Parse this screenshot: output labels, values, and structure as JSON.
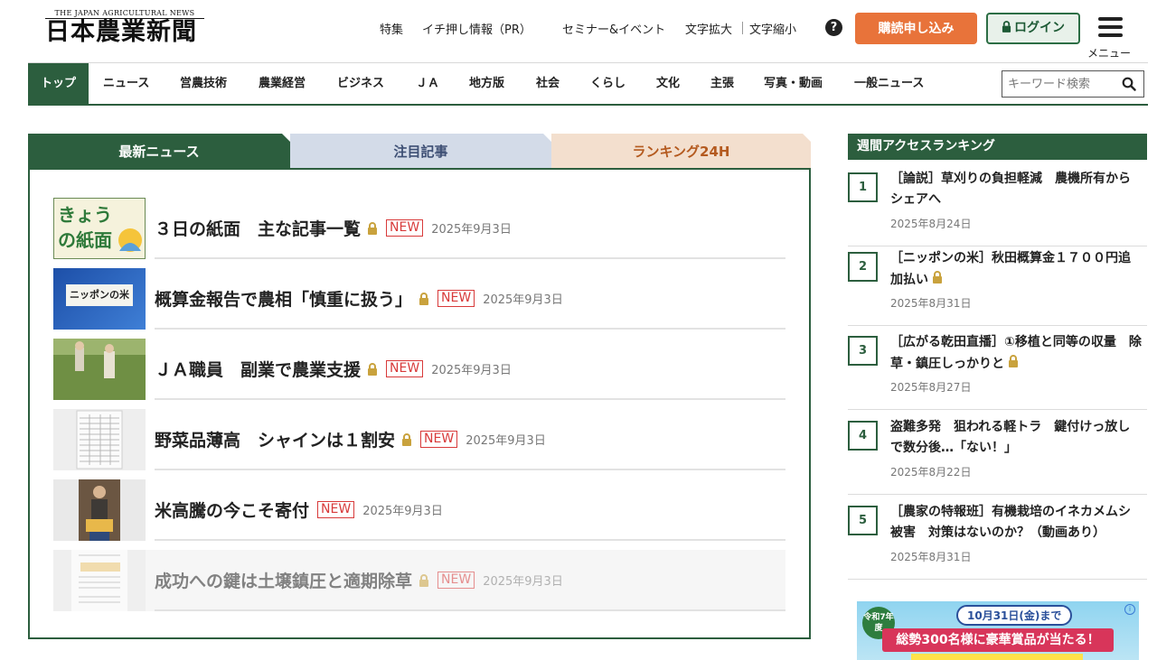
{
  "header": {
    "logo_sub": "THE JAPAN AGRICULTURAL NEWS",
    "logo_main": "日本農業新聞",
    "links": [
      "特集",
      "イチ押し情報（PR）",
      "セミナー&イベント",
      "文字拡大",
      "文字縮小"
    ],
    "subscribe": "購読申し込み",
    "login": "ログイン",
    "menu": "メニュー"
  },
  "nav": {
    "categories": [
      "トップ",
      "ニュース",
      "営農技術",
      "農業経営",
      "ビジネス",
      "ＪＡ",
      "地方版",
      "社会",
      "くらし",
      "文化",
      "主張",
      "写真・動画",
      "一般ニュース"
    ],
    "search_placeholder": "キーワード検索"
  },
  "tabs": [
    "最新ニュース",
    "注目記事",
    "ランキング24H"
  ],
  "news": [
    {
      "title": "３日の紙面　主な記事一覧",
      "locked": true,
      "badge": "NEW",
      "date": "2025年9月3日",
      "thumb_text": "きょうの紙面"
    },
    {
      "title": "概算金報告で農相「慎重に扱う」",
      "locked": true,
      "badge": "NEW",
      "date": "2025年9月3日",
      "thumb_text": "ニッポンの米"
    },
    {
      "title": "ＪＡ職員　副業で農業支援",
      "locked": true,
      "badge": "NEW",
      "date": "2025年9月3日"
    },
    {
      "title": "野菜品薄高　シャインは１割安",
      "locked": true,
      "badge": "NEW",
      "date": "2025年9月3日"
    },
    {
      "title": "米高騰の今こそ寄付",
      "locked": false,
      "badge": "NEW",
      "date": "2025年9月3日"
    },
    {
      "title": "成功への鍵は土壌鎮圧と適期除草",
      "locked": true,
      "badge": "NEW",
      "date": "2025年9月3日"
    }
  ],
  "ranking": {
    "header": "週間アクセスランキング",
    "items": [
      {
        "rank": "1",
        "title": "［論説］草刈りの負担軽減　農機所有からシェアへ",
        "locked": false,
        "date": "2025年8月24日"
      },
      {
        "rank": "2",
        "title": "［ニッポンの米］秋田概算金１７００円追加払い",
        "locked": true,
        "date": "2025年8月31日"
      },
      {
        "rank": "3",
        "title": "［広がる乾田直播］①移植と同等の収量　除草・鎮圧しっかりと",
        "locked": true,
        "date": "2025年8月27日"
      },
      {
        "rank": "4",
        "title": "盗難多発　狙われる軽トラ　鍵付けっ放しで数分後…「ない！」",
        "locked": false,
        "date": "2025年8月22日"
      },
      {
        "rank": "5",
        "title": "［農家の特報班］有機栽培のイネカメムシ被害　対策はないのか？（動画あり）",
        "locked": false,
        "date": "2025年8月31日"
      }
    ]
  },
  "ad": {
    "era": "令和7年度",
    "deadline": "10月31日(金)まで",
    "ribbon": "総勢300名様に豪華賞品が当たる！"
  },
  "colors": {
    "brand_green": "#2c5e3e",
    "subscribe_orange": "#e8733a",
    "new_red": "#d83a3a"
  }
}
